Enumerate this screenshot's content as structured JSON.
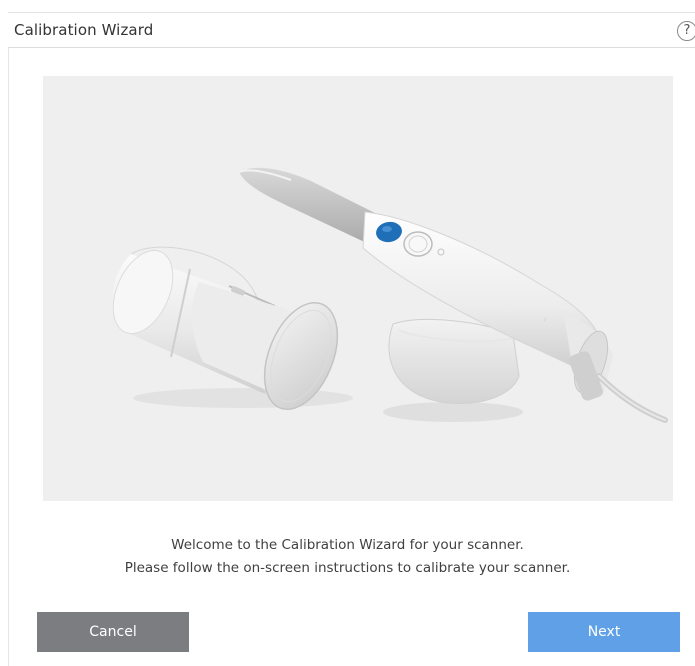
{
  "window": {
    "title": "Calibration Wizard",
    "help_label": "?"
  },
  "illustration": {
    "subject": "scanner-and-calibration-tool"
  },
  "message": {
    "line1": "Welcome to the Calibration Wizard for your scanner.",
    "line2": "Please follow the on-screen instructions to calibrate your scanner."
  },
  "buttons": {
    "cancel": "Cancel",
    "next": "Next"
  },
  "colors": {
    "cancel_bg": "#7b7d80",
    "next_bg": "#5fa0e6",
    "scanner_button": "#1f6fb8"
  }
}
